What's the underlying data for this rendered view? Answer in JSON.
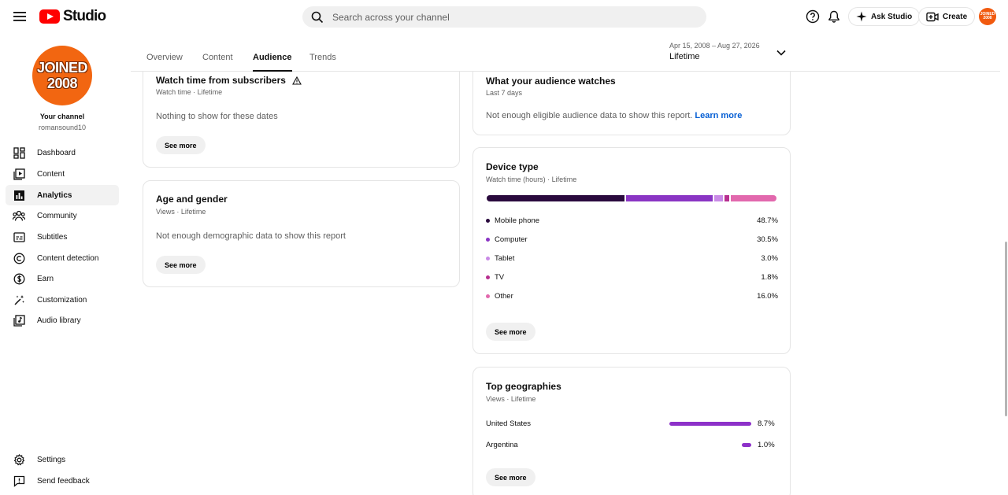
{
  "header": {
    "logo_text": "Studio",
    "search_placeholder": "Search across your channel",
    "ask_studio_label": "Ask Studio",
    "create_label": "Create",
    "avatar_text": "JOINED 2008"
  },
  "sidebar": {
    "avatar_line1": "JOINED",
    "avatar_line2": "2008",
    "your_channel": "Your channel",
    "handle": "romansound10",
    "items": [
      {
        "label": "Dashboard",
        "icon": "dashboard-icon"
      },
      {
        "label": "Content",
        "icon": "content-icon"
      },
      {
        "label": "Analytics",
        "icon": "analytics-icon"
      },
      {
        "label": "Community",
        "icon": "community-icon"
      },
      {
        "label": "Subtitles",
        "icon": "subtitles-icon"
      },
      {
        "label": "Content detection",
        "icon": "copyright-icon"
      },
      {
        "label": "Earn",
        "icon": "earn-icon"
      },
      {
        "label": "Customization",
        "icon": "customization-icon"
      },
      {
        "label": "Audio library",
        "icon": "audio-library-icon"
      }
    ],
    "bottom": [
      {
        "label": "Settings",
        "icon": "gear-icon"
      },
      {
        "label": "Send feedback",
        "icon": "feedback-icon"
      }
    ]
  },
  "tabs": {
    "items": [
      "Overview",
      "Content",
      "Audience",
      "Trends"
    ],
    "active": "Audience",
    "date_range": "Apr 15, 2008 – Aug 27, 2026",
    "date_preset": "Lifetime"
  },
  "cards": {
    "watch_subs": {
      "title": "Watch time from subscribers",
      "subtitle": "Watch time · Lifetime",
      "message": "Nothing to show for these dates",
      "button": "See more"
    },
    "age_gender": {
      "title": "Age and gender",
      "subtitle": "Views · Lifetime",
      "message": "Not enough demographic data to show this report",
      "button": "See more"
    },
    "audience_watches": {
      "title": "What your audience watches",
      "subtitle": "Last 7 days",
      "message": "Not enough eligible audience data to show this report.",
      "link": "Learn more"
    },
    "device_type": {
      "title": "Device type",
      "subtitle": "Watch time (hours) · Lifetime",
      "button": "See more",
      "items": [
        {
          "label": "Mobile phone",
          "value": "48.7%",
          "pct": 48.7,
          "color": "#2a0a3d"
        },
        {
          "label": "Computer",
          "value": "30.5%",
          "pct": 30.5,
          "color": "#8a35c4"
        },
        {
          "label": "Tablet",
          "value": "3.0%",
          "pct": 3.0,
          "color": "#c98ae6"
        },
        {
          "label": "TV",
          "value": "1.8%",
          "pct": 1.8,
          "color": "#b72f8f"
        },
        {
          "label": "Other",
          "value": "16.0%",
          "pct": 16.0,
          "color": "#e268ad"
        }
      ]
    },
    "top_geo": {
      "title": "Top geographies",
      "subtitle": "Views · Lifetime",
      "button": "See more",
      "items": [
        {
          "label": "United States",
          "value": "8.7%",
          "pct": 8.7
        },
        {
          "label": "Argentina",
          "value": "1.0%",
          "pct": 1.0
        }
      ]
    }
  }
}
